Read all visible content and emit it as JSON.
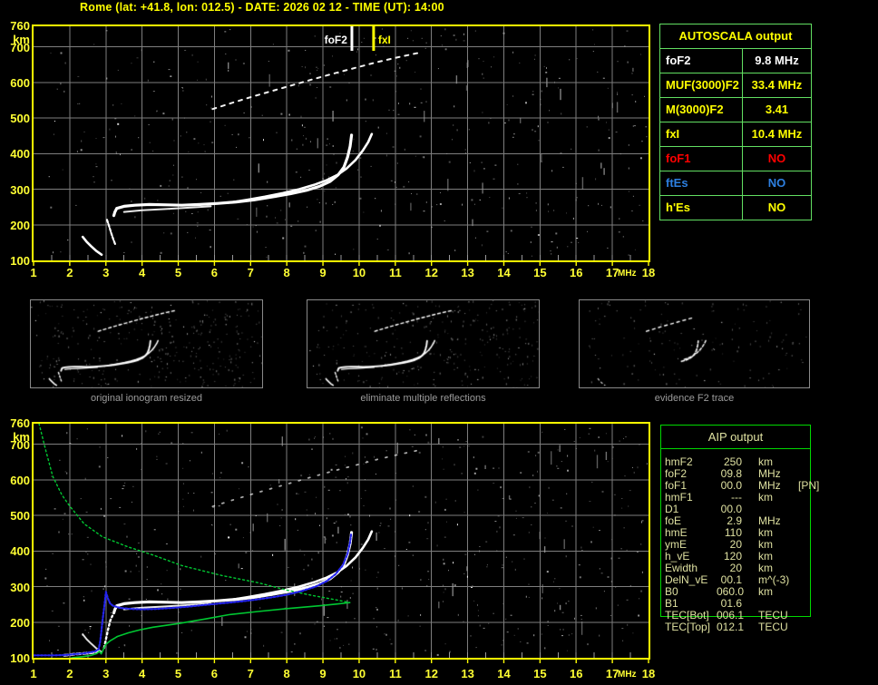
{
  "title": "Rome (lat: +41.8, lon: 012.5) - DATE: 2026 02 12 - TIME (UT): 14:00",
  "colors": {
    "background": "#000000",
    "accent_yellow": "#ffff00",
    "axis_label_yellow": "#ffff33",
    "grid": "#7e7e7e",
    "trace_white": "#ffffff",
    "fit_blue": "#2424ee",
    "profile_green": "#00c832",
    "autoscala_border": "#62df62",
    "aip_border": "#00d800",
    "aip_text": "#dee0a0",
    "no_red": "#ff0000",
    "es_blue": "#2d7fe0",
    "caption_gray": "#9c9c9c",
    "noise_gray": "#aaaaaa"
  },
  "axes": {
    "x_unit": "MHz",
    "y_unit": "km",
    "x_ticks": [
      "1",
      "2",
      "3",
      "4",
      "5",
      "6",
      "7",
      "8",
      "9",
      "10",
      "11",
      "12",
      "13",
      "14",
      "15",
      "16",
      "17",
      "18"
    ],
    "y_ticks": [
      "760",
      "700",
      "600",
      "500",
      "400",
      "300",
      "200",
      "100"
    ]
  },
  "top_plot": {
    "markers": [
      {
        "label": "foF2",
        "freq_mhz": 9.8,
        "color": "#ffffff"
      },
      {
        "label": "fxI",
        "freq_mhz": 10.4,
        "color": "#ffff00"
      }
    ]
  },
  "thumbnails": [
    {
      "caption": "original ionogram resized"
    },
    {
      "caption": "eliminate multiple reflections"
    },
    {
      "caption": "evidence F2 trace"
    }
  ],
  "autoscala": {
    "header": "AUTOSCALA output",
    "rows": [
      {
        "param": "foF2",
        "value": "9.8 MHz",
        "color": "#ffffff"
      },
      {
        "param": "MUF(3000)F2",
        "value": "33.4 MHz",
        "color": "#ffff00"
      },
      {
        "param": "M(3000)F2",
        "value": "3.41",
        "color": "#ffff00"
      },
      {
        "param": "fxI",
        "value": "10.4 MHz",
        "color": "#ffff00"
      },
      {
        "param": "foF1",
        "value": "NO",
        "color": "#ff0000"
      },
      {
        "param": "ftEs",
        "value": "NO",
        "color": "#2d7fe0"
      },
      {
        "param": "h'Es",
        "value": "NO",
        "color": "#ffff00"
      }
    ]
  },
  "aip": {
    "header": "AIP output",
    "rows": [
      {
        "name": "hmF2",
        "value": "250",
        "unit": "km",
        "extra": ""
      },
      {
        "name": "foF2",
        "value": "09.8",
        "unit": "MHz",
        "extra": ""
      },
      {
        "name": "foF1",
        "value": "00.0",
        "unit": "MHz",
        "extra": "[PN]"
      },
      {
        "name": "hmF1",
        "value": "---",
        "unit": "km",
        "extra": ""
      },
      {
        "name": "D1",
        "value": "00.0",
        "unit": "",
        "extra": ""
      },
      {
        "name": "foE",
        "value": "2.9",
        "unit": "MHz",
        "extra": ""
      },
      {
        "name": "hmE",
        "value": "110",
        "unit": "km",
        "extra": ""
      },
      {
        "name": "ymE",
        "value": "20",
        "unit": "km",
        "extra": ""
      },
      {
        "name": "h_vE",
        "value": "120",
        "unit": "km",
        "extra": ""
      },
      {
        "name": "Ewidth",
        "value": "20",
        "unit": "km",
        "extra": ""
      },
      {
        "name": "DelN_vE",
        "value": "00.1",
        "unit": "m^(-3)",
        "extra": ""
      },
      {
        "name": "B0",
        "value": "060.0",
        "unit": "km",
        "extra": ""
      },
      {
        "name": "B1",
        "value": "01.6",
        "unit": "",
        "extra": ""
      },
      {
        "name": "TEC[Bot]",
        "value": "006.1",
        "unit": "TECU",
        "extra": ""
      },
      {
        "name": "TEC[Top]",
        "value": "012.1",
        "unit": "TECU",
        "extra": ""
      }
    ]
  },
  "chart_data": [
    {
      "type": "scatter",
      "title": "ionogram with autoscaled trace markers",
      "xlabel": "MHz",
      "ylabel": "km",
      "xlim": [
        1,
        18
      ],
      "ylim": [
        100,
        760
      ],
      "grid": true,
      "legend_position": "none",
      "annotations": [
        {
          "text": "foF2",
          "x": 9.8
        },
        {
          "text": "fxI",
          "x": 10.4
        }
      ],
      "series": [
        {
          "name": "F2_ordinary_trace",
          "points": [
            [
              3.22,
              226
            ],
            [
              3.25,
              236
            ],
            [
              3.3,
              246
            ],
            [
              3.5,
              252
            ],
            [
              3.8,
              255
            ],
            [
              4.2,
              257
            ],
            [
              4.7,
              256
            ],
            [
              5.1,
              255
            ],
            [
              5.6,
              257
            ],
            [
              6.1,
              260
            ],
            [
              6.6,
              264
            ],
            [
              7.1,
              270
            ],
            [
              7.6,
              278
            ],
            [
              8.1,
              287
            ],
            [
              8.55,
              297
            ],
            [
              8.9,
              308
            ],
            [
              9.2,
              322
            ],
            [
              9.42,
              340
            ],
            [
              9.58,
              362
            ],
            [
              9.68,
              390
            ],
            [
              9.75,
              420
            ],
            [
              9.79,
              452
            ]
          ]
        },
        {
          "name": "F2_ordinary_lower_edge",
          "points": [
            [
              3.5,
              236
            ],
            [
              4.0,
              241
            ],
            [
              4.6,
              244
            ],
            [
              5.3,
              248
            ],
            [
              5.9,
              252
            ]
          ]
        },
        {
          "name": "F2_extraordinary_trace",
          "points": [
            [
              6.4,
              262
            ],
            [
              6.9,
              270
            ],
            [
              7.4,
              279
            ],
            [
              7.9,
              289
            ],
            [
              8.35,
              300
            ],
            [
              8.75,
              312
            ],
            [
              9.1,
              325
            ],
            [
              9.4,
              340
            ],
            [
              9.65,
              358
            ],
            [
              9.9,
              382
            ],
            [
              10.1,
              408
            ],
            [
              10.25,
              432
            ],
            [
              10.35,
              455
            ]
          ]
        },
        {
          "name": "second_reflection_trace",
          "points": [
            [
              5.95,
              525
            ],
            [
              6.5,
              543
            ],
            [
              7.05,
              560
            ],
            [
              7.6,
              576
            ],
            [
              8.15,
              592
            ],
            [
              8.7,
              608
            ],
            [
              9.3,
              625
            ],
            [
              9.9,
              641
            ],
            [
              10.5,
              657
            ],
            [
              11.1,
              671
            ],
            [
              11.7,
              684
            ]
          ]
        },
        {
          "name": "E_region_arc",
          "points": [
            [
              2.36,
              166
            ],
            [
              2.47,
              152
            ],
            [
              2.59,
              140
            ],
            [
              2.73,
              127
            ],
            [
              2.88,
              116
            ]
          ]
        },
        {
          "name": "foE_cusp",
          "points": [
            [
              3.03,
              214
            ],
            [
              3.09,
              195
            ],
            [
              3.15,
              176
            ],
            [
              3.21,
              158
            ],
            [
              3.27,
              142
            ]
          ]
        }
      ]
    },
    {
      "type": "scatter",
      "title": "ionogram with fitted trace and restored electron density profile",
      "xlabel": "MHz",
      "ylabel": "km",
      "xlim": [
        1,
        18
      ],
      "ylim": [
        100,
        760
      ],
      "grid": true,
      "legend_position": "none",
      "includes_white_traces_from_chart": 0,
      "series": [
        {
          "name": "fitted_trace_blue",
          "points": [
            [
              1.0,
              107
            ],
            [
              1.3,
              107
            ],
            [
              1.6,
              107
            ],
            [
              1.9,
              108
            ],
            [
              2.1,
              110
            ],
            [
              2.35,
              112
            ],
            [
              2.55,
              115
            ],
            [
              2.7,
              118
            ],
            [
              2.8,
              124
            ],
            [
              2.84,
              145
            ],
            [
              2.87,
              170
            ],
            [
              2.9,
              200
            ],
            [
              2.95,
              240
            ],
            [
              3.0,
              285
            ],
            [
              3.06,
              265
            ],
            [
              3.12,
              252
            ],
            [
              3.2,
              246
            ],
            [
              3.4,
              240
            ],
            [
              3.7,
              237
            ],
            [
              4.0,
              236
            ],
            [
              4.4,
              237
            ],
            [
              4.8,
              240
            ],
            [
              5.2,
              243
            ],
            [
              5.6,
              247
            ],
            [
              6.0,
              251
            ],
            [
              6.4,
              255
            ],
            [
              6.8,
              259
            ],
            [
              7.2,
              264
            ],
            [
              7.6,
              270
            ],
            [
              8.0,
              277
            ],
            [
              8.4,
              287
            ],
            [
              8.8,
              300
            ],
            [
              9.1,
              315
            ],
            [
              9.35,
              335
            ],
            [
              9.55,
              360
            ],
            [
              9.68,
              392
            ],
            [
              9.75,
              425
            ],
            [
              9.78,
              450
            ]
          ]
        },
        {
          "name": "profile_bottomside_green",
          "points": [
            [
              2.05,
              100
            ],
            [
              2.35,
              103
            ],
            [
              2.6,
              107
            ],
            [
              2.75,
              112
            ],
            [
              2.82,
              118
            ],
            [
              2.87,
              111
            ],
            [
              2.93,
              124
            ],
            [
              3.0,
              138
            ],
            [
              3.12,
              148
            ],
            [
              3.32,
              160
            ],
            [
              3.62,
              170
            ],
            [
              3.92,
              178
            ],
            [
              4.3,
              186
            ],
            [
              5.0,
              196
            ],
            [
              5.7,
              208
            ],
            [
              6.4,
              221
            ],
            [
              7.2,
              230
            ],
            [
              8.0,
              238
            ],
            [
              8.9,
              246
            ],
            [
              9.4,
              251
            ],
            [
              9.74,
              255
            ]
          ]
        },
        {
          "name": "profile_topside_green",
          "points": [
            [
              1.15,
              758
            ],
            [
              1.33,
              685
            ],
            [
              1.53,
              610
            ],
            [
              1.78,
              558
            ],
            [
              2.0,
              526
            ],
            [
              2.4,
              476
            ],
            [
              2.9,
              440
            ],
            [
              3.6,
              412
            ],
            [
              4.35,
              387
            ],
            [
              5.1,
              359
            ],
            [
              6.2,
              331
            ],
            [
              7.2,
              311
            ],
            [
              8.0,
              290
            ],
            [
              8.7,
              275
            ],
            [
              9.4,
              262
            ],
            [
              9.74,
              255
            ]
          ]
        },
        {
          "name": "E_echo_spread",
          "points": [
            [
              2.95,
              128
            ],
            [
              3.0,
              152
            ],
            [
              3.06,
              180
            ],
            [
              3.12,
              205
            ],
            [
              3.18,
              218
            ]
          ]
        },
        {
          "name": "E_echo_flat",
          "points": [
            [
              1.85,
              107
            ],
            [
              2.1,
              110
            ],
            [
              2.35,
              112
            ],
            [
              2.6,
              114
            ],
            [
              2.8,
              118
            ]
          ]
        }
      ]
    }
  ]
}
